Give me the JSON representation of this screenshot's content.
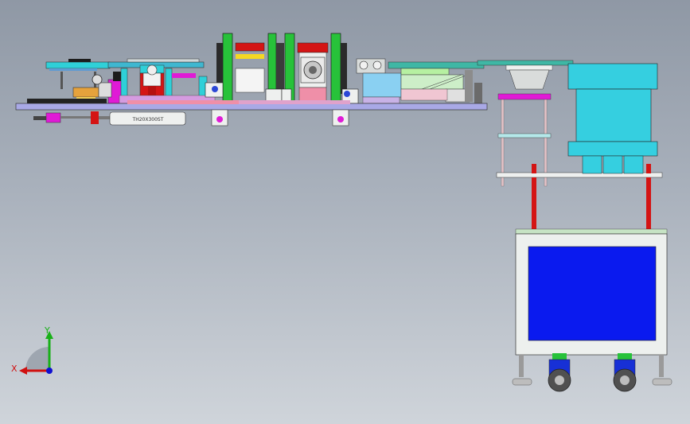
{
  "viewport": {
    "background_top": "#8f98a5",
    "background_bottom": "#cfd4da"
  },
  "triad": {
    "x_label": "X",
    "y_label": "Y",
    "x_color": "#d01010",
    "y_color": "#18b018",
    "z_color": "#1010d0"
  },
  "parts": {
    "cylinder_label": "TH20X300ST"
  },
  "colors": {
    "base_plate": "#a9a9e6",
    "green_frame": "#27c23a",
    "red_block": "#d41414",
    "magenta": "#e01ad6",
    "cyan": "#2fd0d8",
    "bowl": "#35cfe0",
    "cabinet_panel": "#0a1aef",
    "cabinet_body": "#edf0ee",
    "pink": "#ef8fa8"
  }
}
